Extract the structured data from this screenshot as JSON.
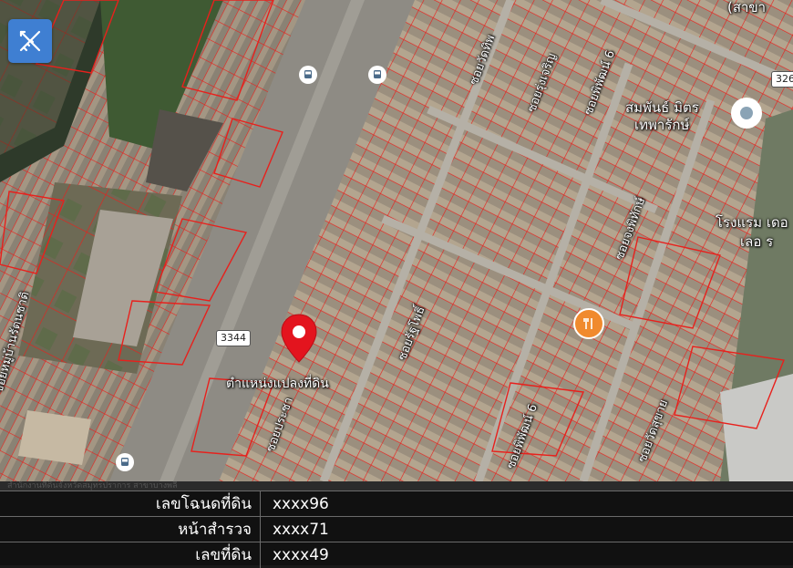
{
  "toolbar": {
    "tool_icon": "ruler-pencil-icon",
    "tool_color": "#3f7fd2"
  },
  "map": {
    "parcel_color": "#e8201c",
    "road_shields": [
      "3344",
      "326"
    ],
    "labels": {
      "marker_caption": "ตำแหน่งแปลงที่ดิน",
      "poi_top": "(สาขา",
      "poi_clinic": "สมพันธ์ มิตร",
      "poi_clinic_2": "เทพารักษ์",
      "poi_school": "โรงแรม เดอ",
      "poi_school_2": "เลอ ร",
      "soi_1": "ซอยวัดทิพ",
      "soi_2": "ซอยรุ่งเจริญ",
      "soi_3": "ซอยพิพัฒน์ 6",
      "soi_4": "ซอยจงพิทักษ์",
      "soi_5": "ซอยรัฐโพธิ์",
      "soi_6": "ซอยพิพัฒน์ 6",
      "soi_7": "ซอยหมู่บ้านรัตนชาติ",
      "soi_8": "ซอยวัดสุขาย",
      "soi_9": "ซอยประชา"
    },
    "icons": [
      "map-marker-icon",
      "bus-stop-icon",
      "bus-stop-icon",
      "bus-stop-icon",
      "restaurant-icon",
      "place-icon"
    ]
  },
  "info": {
    "strip_text": "สำนักงานที่ดินจังหวัดสมุทรปราการ สาขาบางพลี",
    "rows": [
      {
        "key": "เลขโฉนดที่ดิน",
        "value": "xxxx96"
      },
      {
        "key": "หน้าสำรวจ",
        "value": "xxxx71"
      },
      {
        "key": "เลขที่ดิน",
        "value": "xxxx49"
      }
    ]
  }
}
